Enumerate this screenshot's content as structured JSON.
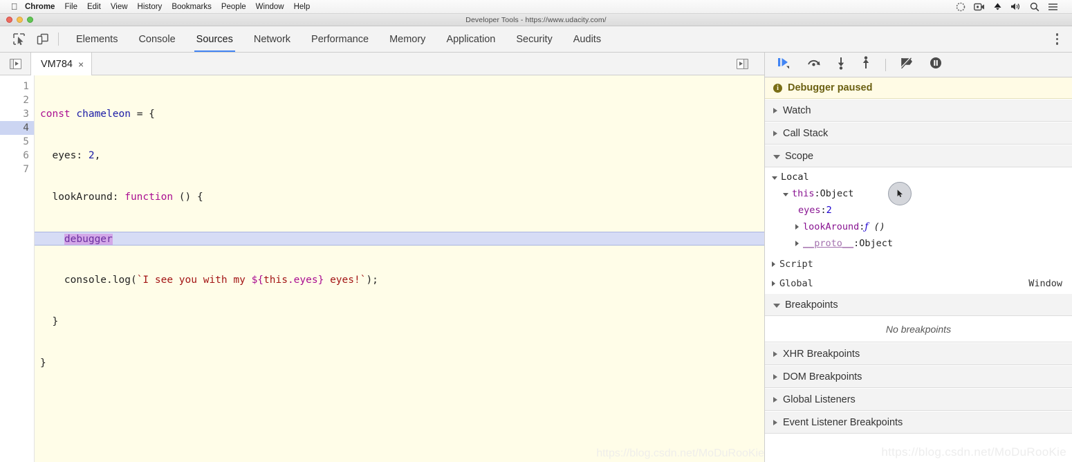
{
  "menubar": {
    "apple": "",
    "items": [
      {
        "label": "Chrome",
        "bold": true
      },
      {
        "label": "File",
        "bold": false
      },
      {
        "label": "Edit",
        "bold": false
      },
      {
        "label": "View",
        "bold": false
      },
      {
        "label": "History",
        "bold": false
      },
      {
        "label": "Bookmarks",
        "bold": false
      },
      {
        "label": "People",
        "bold": false
      },
      {
        "label": "Window",
        "bold": false
      },
      {
        "label": "Help",
        "bold": false
      }
    ],
    "status_icons": [
      "dotted-circle-icon",
      "screen-record-icon",
      "dropbox-icon",
      "volume-icon",
      "spotlight-search-icon",
      "control-center-icon"
    ]
  },
  "window": {
    "title": "Developer Tools - https://www.udacity.com/",
    "traffic_lights": [
      "close-button",
      "minimize-button",
      "zoom-button"
    ]
  },
  "devtools": {
    "left_icons": [
      "inspect-element-icon",
      "device-toolbar-icon"
    ],
    "tabs": [
      {
        "label": "Elements",
        "active": false
      },
      {
        "label": "Console",
        "active": false
      },
      {
        "label": "Sources",
        "active": true
      },
      {
        "label": "Network",
        "active": false
      },
      {
        "label": "Performance",
        "active": false
      },
      {
        "label": "Memory",
        "active": false
      },
      {
        "label": "Application",
        "active": false
      },
      {
        "label": "Security",
        "active": false
      },
      {
        "label": "Audits",
        "active": false
      }
    ],
    "more_menu": "kebab-menu-icon",
    "accent_color": "#4285f4"
  },
  "sources": {
    "navigator_toggle": "show-navigator-icon",
    "file_tab": {
      "label": "VM784",
      "close": "×"
    },
    "right_toggle": "show-debugger-sidebar-icon",
    "editor": {
      "highlighted_line": 4,
      "line_numbers": [
        "1",
        "2",
        "3",
        "4",
        "5",
        "6",
        "7"
      ],
      "lines": [
        "const chameleon = {",
        "  eyes: 2,",
        "  lookAround: function () {",
        "    debugger",
        "    console.log(`I see you with my ${this.eyes} eyes!`);",
        "  }",
        "}"
      ],
      "background_color": "#fffde8",
      "highlight_color": "#d6dcf5"
    }
  },
  "debugger": {
    "toolbar": [
      {
        "name": "resume-script-execution-button",
        "title": "Resume"
      },
      {
        "name": "step-over-button",
        "title": "Step over next function call"
      },
      {
        "name": "step-into-button",
        "title": "Step into next function call"
      },
      {
        "name": "step-out-button",
        "title": "Step out of current function"
      },
      {
        "name": "deactivate-breakpoints-button",
        "title": "Deactivate breakpoints"
      },
      {
        "name": "pause-on-exceptions-button",
        "title": "Pause on exceptions"
      }
    ],
    "paused_banner": {
      "text": "Debugger paused",
      "icon": "info-icon",
      "bg": "#fffbe5",
      "fg": "#6b6012"
    },
    "sections": [
      {
        "label": "Watch",
        "expanded": false
      },
      {
        "label": "Call Stack",
        "expanded": false
      },
      {
        "label": "Scope",
        "expanded": true
      }
    ],
    "scope": {
      "rows": [
        {
          "indent": 0,
          "arrow": "open",
          "name": "Local",
          "sep": "",
          "value": "",
          "kind": "plain"
        },
        {
          "indent": 1,
          "arrow": "open",
          "name": "this",
          "sep": ": ",
          "value": "Object",
          "kind": "object"
        },
        {
          "indent": 2,
          "arrow": "none",
          "name": "eyes",
          "sep": ": ",
          "value": "2",
          "kind": "number"
        },
        {
          "indent": 3,
          "arrow": "closed",
          "name": "lookAround",
          "sep": ": ",
          "value": "f ()",
          "kind": "function"
        },
        {
          "indent": 3,
          "arrow": "closed",
          "name": "__proto__",
          "sep": ": ",
          "value": "Object",
          "kind": "proto"
        }
      ],
      "cursor_overlay": "mouse-cursor-highlight"
    },
    "lower_sections": [
      {
        "label": "Script",
        "expanded": false,
        "right": ""
      },
      {
        "label": "Global",
        "expanded": false,
        "right": "Window"
      },
      {
        "label": "Breakpoints",
        "expanded": true,
        "right": ""
      }
    ],
    "no_breakpoints": "No breakpoints",
    "trailing_sections": [
      {
        "label": "XHR Breakpoints",
        "expanded": false
      },
      {
        "label": "DOM Breakpoints",
        "expanded": false
      },
      {
        "label": "Global Listeners",
        "expanded": false
      },
      {
        "label": "Event Listener Breakpoints",
        "expanded": false
      }
    ]
  },
  "watermark": "https://blog.csdn.net/MoDuRooKie"
}
